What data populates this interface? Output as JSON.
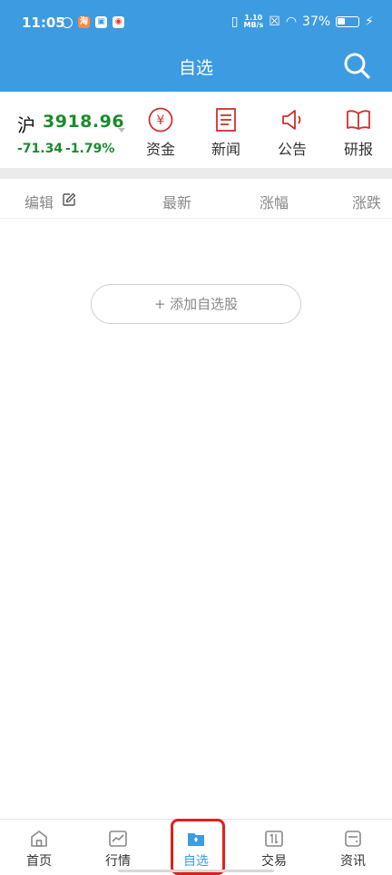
{
  "status": {
    "time": "11:05",
    "net_speed_value": "1.10",
    "net_speed_unit": "MB/s",
    "battery": "37%"
  },
  "header": {
    "title": "自选"
  },
  "index_quote": {
    "name": "沪",
    "value": "3918.96",
    "change": "-71.34",
    "change_pct": "-1.79%",
    "color": "#1a8c2c"
  },
  "shortcuts": [
    {
      "label": "资金",
      "icon": "yuan-circle-icon"
    },
    {
      "label": "新闻",
      "icon": "news-doc-icon"
    },
    {
      "label": "公告",
      "icon": "megaphone-icon"
    },
    {
      "label": "研报",
      "icon": "open-book-icon"
    }
  ],
  "list_header": {
    "edit": "编辑",
    "latest": "最新",
    "change_pct": "涨幅",
    "change_amt": "涨跌"
  },
  "add_stock": {
    "label": "+ 添加自选股"
  },
  "tabs": [
    {
      "label": "首页",
      "icon": "home-icon"
    },
    {
      "label": "行情",
      "icon": "chart-icon"
    },
    {
      "label": "自选",
      "icon": "folder-icon",
      "active": true
    },
    {
      "label": "交易",
      "icon": "trade-icon"
    },
    {
      "label": "资讯",
      "icon": "info-icon"
    }
  ],
  "colors": {
    "brand": "#3d9be2",
    "accent_red": "#d03030",
    "down_green": "#1a8c2c"
  }
}
